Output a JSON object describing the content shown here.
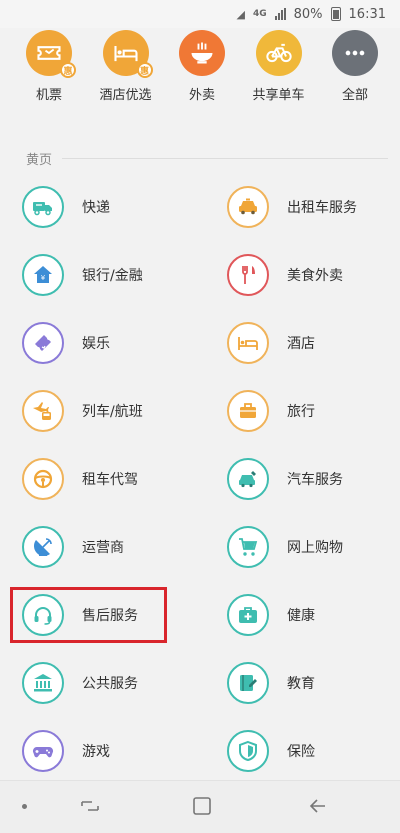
{
  "status_bar": {
    "network": "4G",
    "battery": "80%",
    "time": "16:31"
  },
  "top_row": [
    {
      "label": "机票",
      "icon": "ticket-icon",
      "color": "#f0a638",
      "badge": "惠"
    },
    {
      "label": "酒店优选",
      "icon": "bed-icon",
      "color": "#f0a638",
      "badge": "惠"
    },
    {
      "label": "外卖",
      "icon": "bowl-icon",
      "color": "#f07835",
      "badge": ""
    },
    {
      "label": "共享单车",
      "icon": "bicycle-icon",
      "color": "#f0b83a",
      "badge": ""
    },
    {
      "label": "全部",
      "icon": "more-icon",
      "color": "#6c7178",
      "badge": ""
    }
  ],
  "section": {
    "title": "黄页"
  },
  "services": [
    [
      {
        "label": "快递",
        "icon": "truck-icon",
        "color": "#3fbdb0"
      },
      {
        "label": "出租车服务",
        "icon": "taxi-icon",
        "color": "#f0b35a"
      }
    ],
    [
      {
        "label": "银行/金融",
        "icon": "bank-house-icon",
        "color": "#3fbdb0"
      },
      {
        "label": "美食外卖",
        "icon": "fork-knife-icon",
        "color": "#e0575a"
      }
    ],
    [
      {
        "label": "娱乐",
        "icon": "ticket-star-icon",
        "color": "#8a7ad8"
      },
      {
        "label": "酒店",
        "icon": "bed-icon",
        "color": "#f0b35a"
      }
    ],
    [
      {
        "label": "列车/航班",
        "icon": "plane-train-icon",
        "color": "#f0b35a"
      },
      {
        "label": "旅行",
        "icon": "luggage-icon",
        "color": "#f0b35a"
      }
    ],
    [
      {
        "label": "租车代驾",
        "icon": "steering-wheel-icon",
        "color": "#f0b35a"
      },
      {
        "label": "汽车服务",
        "icon": "car-wrench-icon",
        "color": "#3fbdb0"
      }
    ],
    [
      {
        "label": "运营商",
        "icon": "satellite-dish-icon",
        "color": "#3fbdb0"
      },
      {
        "label": "网上购物",
        "icon": "shopping-cart-icon",
        "color": "#3fbdb0"
      }
    ],
    [
      {
        "label": "售后服务",
        "icon": "headset-icon",
        "color": "#3fbdb0"
      },
      {
        "label": "健康",
        "icon": "medical-kit-icon",
        "color": "#3fbdb0"
      }
    ],
    [
      {
        "label": "公共服务",
        "icon": "government-building-icon",
        "color": "#3fbdb0"
      },
      {
        "label": "教育",
        "icon": "book-pen-icon",
        "color": "#3fbdb0"
      }
    ],
    [
      {
        "label": "游戏",
        "icon": "gamepad-icon",
        "color": "#8a7ad8"
      },
      {
        "label": "保险",
        "icon": "shield-icon",
        "color": "#3fbdb0"
      }
    ]
  ]
}
